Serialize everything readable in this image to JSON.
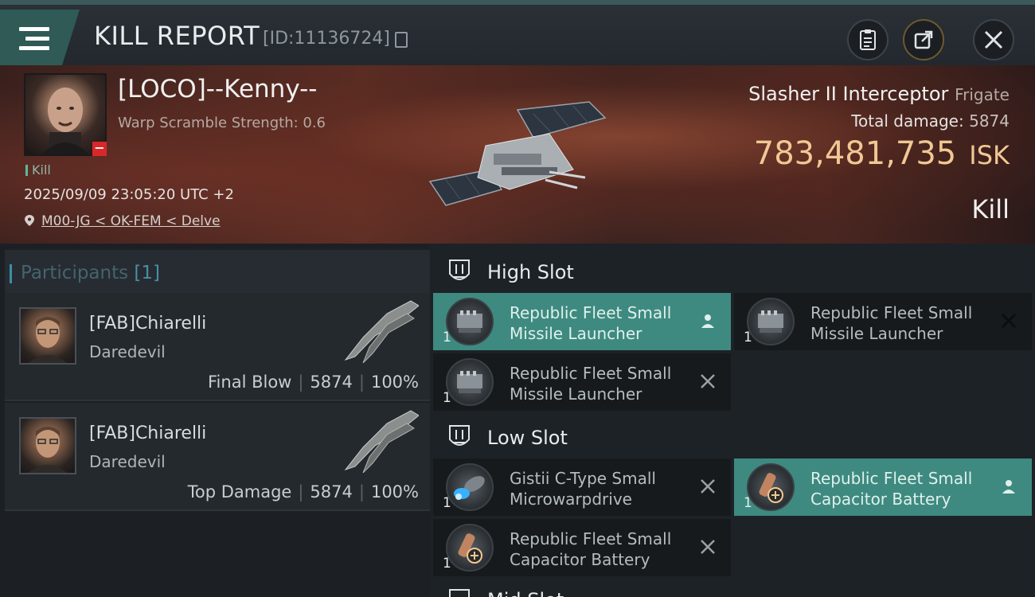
{
  "header": {
    "title": "KILL REPORT",
    "id_text": "[ID:11136724]"
  },
  "victim": {
    "name": "[LOCO]--Kenny--",
    "scramble": "Warp Scramble Strength: 0.6",
    "kill_tag": "Kill",
    "datetime": "2025/09/09 23:05:20 UTC +2",
    "location": "M00-JG < OK-FEM < Delve",
    "ship_name": "Slasher II Interceptor",
    "ship_class": "Frigate",
    "total_damage_label": "Total damage:",
    "total_damage": "5874",
    "isk_value": "783,481,735",
    "isk_unit": "ISK",
    "result": "Kill"
  },
  "participants": {
    "label": "Participants",
    "count": "[1]",
    "rows": [
      {
        "name": "[FAB]Chiarelli",
        "ship": "Daredevil",
        "role": "Final Blow",
        "damage": "5874",
        "percent": "100%"
      },
      {
        "name": "[FAB]Chiarelli",
        "ship": "Daredevil",
        "role": "Top Damage",
        "damage": "5874",
        "percent": "100%"
      }
    ]
  },
  "fitting": {
    "high_slot_title": "High Slot",
    "low_slot_title": "Low Slot",
    "mid_slot_title": "Mid Slot",
    "high": [
      {
        "qty": "1",
        "line1": "Republic Fleet Small",
        "line2": "Missile Launcher",
        "status": "dropped",
        "icon": "missile-launcher-icon"
      },
      {
        "qty": "1",
        "line1": "Republic Fleet Small",
        "line2": "Missile Launcher",
        "status": "destroyed",
        "icon": "missile-launcher-icon"
      },
      {
        "qty": "1",
        "line1": "Republic Fleet Small",
        "line2": "Missile Launcher",
        "status": "destroyed",
        "icon": "missile-launcher-icon"
      }
    ],
    "low": [
      {
        "qty": "1",
        "line1": "Gistii C-Type Small",
        "line2": "Microwarpdrive",
        "status": "destroyed",
        "icon": "microwarpdrive-icon"
      },
      {
        "qty": "1",
        "line1": "Republic Fleet Small",
        "line2": "Capacitor Battery",
        "status": "dropped",
        "icon": "capacitor-battery-icon"
      },
      {
        "qty": "1",
        "line1": "Republic Fleet Small",
        "line2": "Capacitor Battery",
        "status": "destroyed",
        "icon": "capacitor-battery-icon"
      }
    ]
  },
  "colors": {
    "accent_teal": "#3e8a80",
    "isk_gold": "#f0c894",
    "negative_red": "#d8282a"
  }
}
